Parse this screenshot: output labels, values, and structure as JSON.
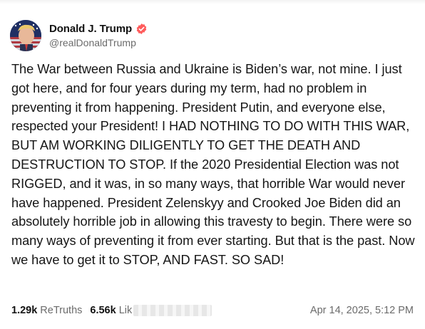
{
  "author": {
    "display_name": "Donald J. Trump",
    "handle": "@realDonaldTrump",
    "verified_color": "#ff5c5c"
  },
  "post": {
    "text": "The War between Russia and Ukraine is Biden’s war, not mine. I just got here, and for four years during my term, had no problem in preventing it from happening. President Putin, and everyone else, respected your President! I HAD NOTHING TO DO WITH THIS WAR, BUT AM WORKING DILIGENTLY TO GET THE DEATH AND DESTRUCTION TO STOP. If the 2020 Presidential Election was not RIGGED, and it was, in so many ways, that horrible War would never have happened. President Zelenskyy and Crooked Joe Biden did an absolutely horrible job in allowing this travesty to begin. There were so many ways of preventing it from ever starting. But that is the past. Now we have to get it to STOP, AND FAST. SO SAD!"
  },
  "stats": {
    "retruths_count": "1.29k",
    "retruths_label": "ReTruths",
    "likes_count": "6.56k",
    "likes_label": "Lik"
  },
  "timestamp": "Apr 14, 2025, 5:12 PM",
  "icons": {
    "verified": "verified-badge-icon",
    "avatar": "profile-avatar-image"
  }
}
